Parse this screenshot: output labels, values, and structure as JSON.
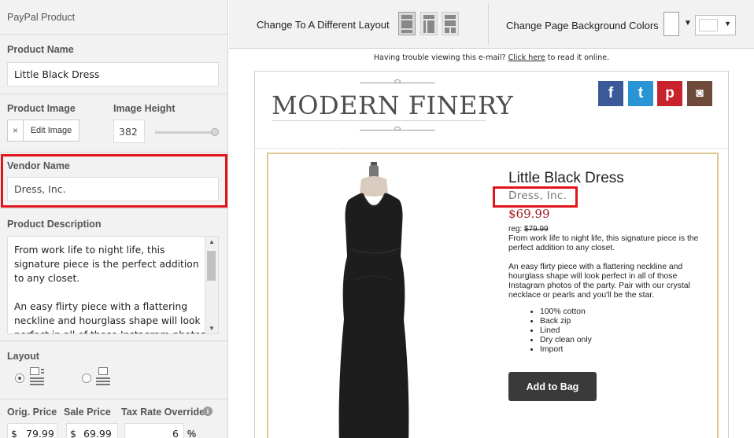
{
  "sidebar": {
    "header": "PayPal Product",
    "product_name": {
      "label": "Product Name",
      "value": "Little Black Dress"
    },
    "product_image": {
      "label": "Product Image",
      "remove": "×",
      "edit_button": "Edit Image"
    },
    "image_height": {
      "label": "Image Height",
      "value": "382"
    },
    "vendor_name": {
      "label": "Vendor Name",
      "value": "Dress, Inc."
    },
    "product_description": {
      "label": "Product Description",
      "value": "From work life to night life, this signature piece is the perfect addition to any closet.\n\nAn easy flirty piece with a flattering neckline and hourglass shape will look perfect in all of those Instagram photos"
    },
    "layout": {
      "label": "Layout",
      "selected": "image-left"
    },
    "pricing": {
      "orig_label": "Orig. Price",
      "sale_label": "Sale Price",
      "tax_label": "Tax Rate Override",
      "currency": "$",
      "orig_value": "79.99",
      "sale_value": "69.99",
      "tax_value": "6",
      "tax_unit": "%"
    }
  },
  "toolbar": {
    "layout_label": "Change To A Different Layout",
    "bg_label": "Change Page Background Colors",
    "dropdown_arrow": "▼"
  },
  "email": {
    "trouble_text": "Having trouble viewing this e-mail?",
    "click_here": "Click here",
    "trouble_tail": "to read it online.",
    "logo": "MODERN FINERY",
    "social": [
      {
        "icon": "facebook-icon",
        "glyph": "f",
        "color": "#3b5998"
      },
      {
        "icon": "twitter-icon",
        "glyph": "t",
        "color": "#2a95d5"
      },
      {
        "icon": "pinterest-icon",
        "glyph": "p",
        "color": "#c8232c"
      },
      {
        "icon": "instagram-icon",
        "glyph": "◙",
        "color": "#6e4a3a"
      }
    ],
    "product": {
      "title": "Little Black Dress",
      "vendor": "Dress, Inc.",
      "price": "$69.99",
      "reg_label": "reg:",
      "reg_price": "$79.99",
      "description": "From work life to night life, this signature piece is the perfect addition to any closet.\n\nAn easy flirty piece with a flattering neckline and hourglass shape will look perfect in all of those Instagram photos of the party.  Pair with our crystal necklace or pearls and you'll be the star.",
      "features": [
        "100% cotton",
        "Back zip",
        "Lined",
        "Dry clean only",
        "Import"
      ],
      "button": "Add to Bag"
    }
  },
  "colors": {
    "highlight": "#e0151b",
    "price": "#a41d21",
    "border_gold": "#dfc58f"
  }
}
